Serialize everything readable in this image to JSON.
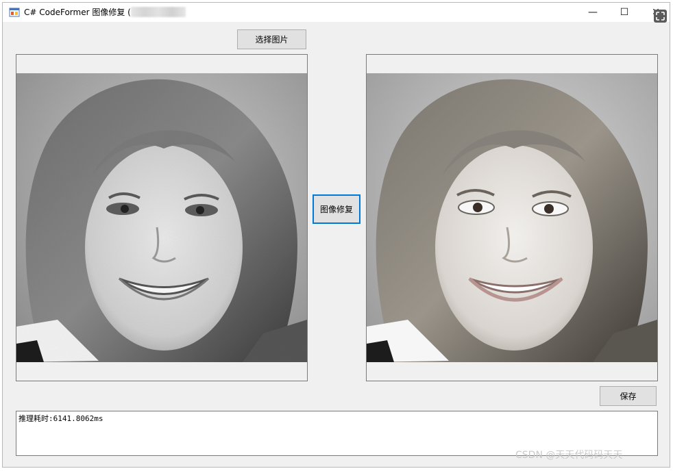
{
  "window": {
    "title": "C# CodeFormer 图像修复 (",
    "controls": {
      "minimize": "—",
      "maximize": "☐",
      "close": "✕"
    }
  },
  "toolbar": {
    "select_image_label": "选择图片"
  },
  "actions": {
    "restore_label": "图像修复",
    "save_label": "保存"
  },
  "panels": {
    "input_image": "portrait-original-grainy",
    "output_image": "portrait-restored"
  },
  "log": {
    "text": "推理耗时:6141.8062ms"
  },
  "watermark": "CSDN @天天代码码天天",
  "colors": {
    "window_bg": "#f0f0f0",
    "button_bg": "#e1e1e1",
    "focus_border": "#0078d7"
  }
}
